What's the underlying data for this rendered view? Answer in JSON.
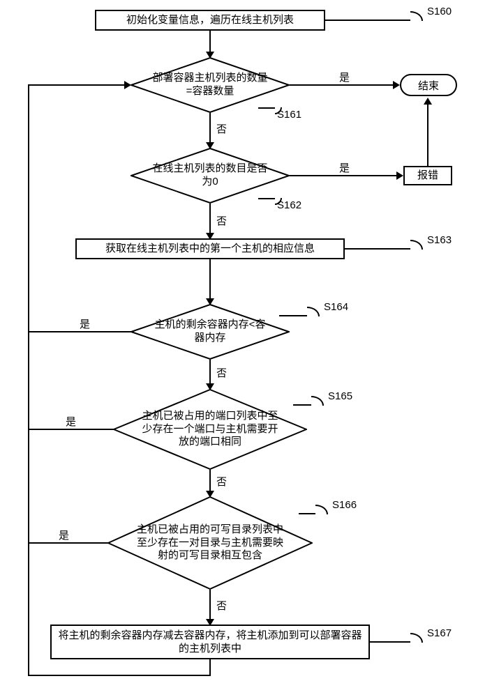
{
  "steps": {
    "s160": {
      "text": "初始化变量信息，遍历在线主机列表",
      "tag": "S160"
    },
    "s161": {
      "text": "部署容器主机列表的数量=容器数量",
      "tag": "S161"
    },
    "s162": {
      "text": "在线主机列表的数目是否为0",
      "tag": "S162"
    },
    "s163": {
      "text": "获取在线主机列表中的第一个主机的相应信息",
      "tag": "S163"
    },
    "s164": {
      "text": "主机的剩余容器内存<容器内存",
      "tag": "S164"
    },
    "s165": {
      "text": "主机已被占用的端口列表中至少存在一个端口与主机需要开放的端口相同",
      "tag": "S165"
    },
    "s166": {
      "text": "主机已被占用的可写目录列表中至少存在一对目录与主机需要映射的可写目录相互包含",
      "tag": "S166"
    },
    "s167": {
      "text": "将主机的剩余容器内存减去容器内存，将主机添加到可以部署容器的主机列表中",
      "tag": "S167"
    }
  },
  "labels": {
    "yes": "是",
    "no": "否",
    "end": "结束",
    "error": "报错"
  },
  "chart_data": {
    "type": "flowchart",
    "nodes": [
      {
        "id": "S160",
        "shape": "process",
        "text": "初始化变量信息，遍历在线主机列表"
      },
      {
        "id": "S161",
        "shape": "decision",
        "text": "部署容器主机列表的数量=容器数量"
      },
      {
        "id": "S162",
        "shape": "decision",
        "text": "在线主机列表的数目是否为0"
      },
      {
        "id": "S163",
        "shape": "process",
        "text": "获取在线主机列表中的第一个主机的相应信息"
      },
      {
        "id": "S164",
        "shape": "decision",
        "text": "主机的剩余容器内存<容器内存"
      },
      {
        "id": "S165",
        "shape": "decision",
        "text": "主机已被占用的端口列表中至少存在一个端口与主机需要开放的端口相同"
      },
      {
        "id": "S166",
        "shape": "decision",
        "text": "主机已被占用的可写目录列表中至少存在一对目录与主机需要映射的可写目录相互包含"
      },
      {
        "id": "S167",
        "shape": "process",
        "text": "将主机的剩余容器内存减去容器内存，将主机添加到可以部署容器的主机列表中"
      },
      {
        "id": "END",
        "shape": "terminator",
        "text": "结束"
      },
      {
        "id": "ERR",
        "shape": "process",
        "text": "报错"
      }
    ],
    "edges": [
      {
        "from": "S160",
        "to": "S161"
      },
      {
        "from": "S161",
        "to": "END",
        "label": "是"
      },
      {
        "from": "S161",
        "to": "S162",
        "label": "否"
      },
      {
        "from": "S162",
        "to": "ERR",
        "label": "是"
      },
      {
        "from": "ERR",
        "to": "END"
      },
      {
        "from": "S162",
        "to": "S163",
        "label": "否"
      },
      {
        "from": "S163",
        "to": "S164"
      },
      {
        "from": "S164",
        "to": "S161",
        "label": "是"
      },
      {
        "from": "S164",
        "to": "S165",
        "label": "否"
      },
      {
        "from": "S165",
        "to": "S161",
        "label": "是"
      },
      {
        "from": "S165",
        "to": "S166",
        "label": "否"
      },
      {
        "from": "S166",
        "to": "S161",
        "label": "是"
      },
      {
        "from": "S166",
        "to": "S167",
        "label": "否"
      },
      {
        "from": "S167",
        "to": "S161"
      }
    ]
  }
}
